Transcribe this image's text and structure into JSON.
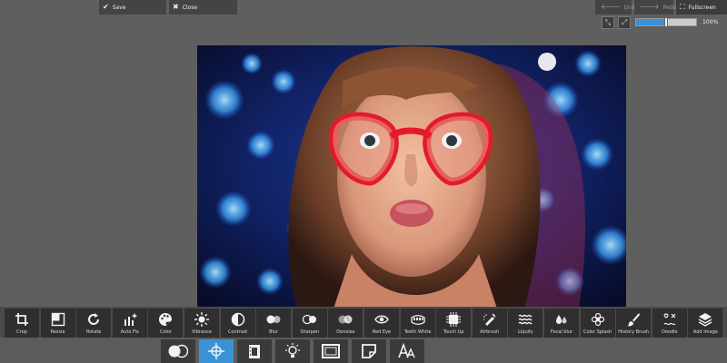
{
  "header": {
    "save_label": "Save",
    "close_label": "Close",
    "undo_label": "Undo",
    "redo_label": "Redo",
    "fullscreen_label": "Fullscreen"
  },
  "zoom": {
    "value_text": "100%",
    "level_fraction": 0.5
  },
  "colors": {
    "accent": "#3a93d6",
    "toolbar_bg": "#2f2f2f",
    "canvas_bg": "#5f5f5f"
  },
  "tools": [
    {
      "label": "Crop",
      "icon": "crop-icon"
    },
    {
      "label": "Resize",
      "icon": "resize-icon"
    },
    {
      "label": "Rotate",
      "icon": "rotate-icon"
    },
    {
      "label": "Auto Fix",
      "icon": "auto-fix-icon"
    },
    {
      "label": "Color",
      "icon": "palette-icon"
    },
    {
      "label": "Vibrance",
      "icon": "sun-icon"
    },
    {
      "label": "Contrast",
      "icon": "contrast-icon"
    },
    {
      "label": "Blur",
      "icon": "blur-icon"
    },
    {
      "label": "Sharpen",
      "icon": "sharpen-icon"
    },
    {
      "label": "Denoise",
      "icon": "denoise-icon"
    },
    {
      "label": "Red Eye",
      "icon": "eye-icon"
    },
    {
      "label": "Teeth White",
      "icon": "teeth-icon"
    },
    {
      "label": "Touch Up",
      "icon": "touch-up-icon"
    },
    {
      "label": "Airbrush",
      "icon": "airbrush-icon"
    },
    {
      "label": "Liquify",
      "icon": "waves-icon"
    },
    {
      "label": "Focal blur",
      "icon": "drops-icon"
    },
    {
      "label": "Color Splash",
      "icon": "flower-icon"
    },
    {
      "label": "History Brush",
      "icon": "brush-icon"
    },
    {
      "label": "Doodle",
      "icon": "doodle-icon"
    },
    {
      "label": "Add Image",
      "icon": "layers-icon"
    }
  ],
  "subtabs": [
    {
      "icon": "adjust-circles-icon",
      "active": false
    },
    {
      "icon": "crosshair-icon",
      "active": true
    },
    {
      "icon": "film-icon",
      "active": false
    },
    {
      "icon": "light-bulb-icon",
      "active": false
    },
    {
      "icon": "frame-icon",
      "active": false
    },
    {
      "icon": "sticker-icon",
      "active": false
    },
    {
      "icon": "text-icon",
      "active": false
    }
  ]
}
